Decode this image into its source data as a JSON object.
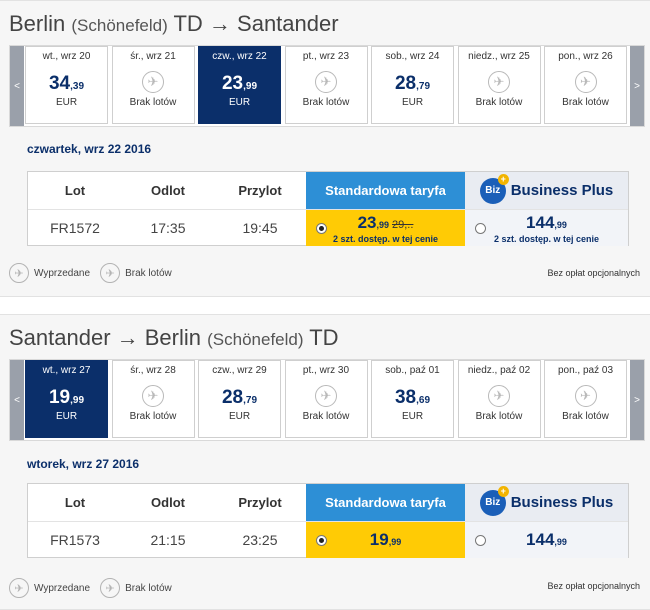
{
  "outbound": {
    "route_main": "Berlin",
    "route_small": "(Schönefeld)",
    "route_rest": " TD → Santander",
    "days": [
      {
        "label": "wt., wrz 20",
        "price_main": "34",
        "price_dec": ",39",
        "currency": "EUR",
        "selected": false
      },
      {
        "label": "śr., wrz 21",
        "no_flights": "Brak lotów",
        "selected": false
      },
      {
        "label": "czw., wrz 22",
        "price_main": "23",
        "price_dec": ",99",
        "currency": "EUR",
        "selected": true
      },
      {
        "label": "pt., wrz 23",
        "no_flights": "Brak lotów",
        "selected": false
      },
      {
        "label": "sob., wrz 24",
        "price_main": "28",
        "price_dec": ",79",
        "currency": "EUR",
        "selected": false
      },
      {
        "label": "niedz., wrz 25",
        "no_flights": "Brak lotów",
        "selected": false
      },
      {
        "label": "pon., wrz 26",
        "no_flights": "Brak lotów",
        "selected": false
      }
    ],
    "date_heading": "czwartek, wrz 22 2016",
    "headers": {
      "flight": "Lot",
      "departure": "Odlot",
      "arrival": "Przylot",
      "standard": "Standardowa taryfa",
      "business": "Business Plus"
    },
    "row": {
      "flight": "FR1572",
      "departure": "17:35",
      "arrival": "19:45",
      "std_main": "23",
      "std_dec": ",99",
      "std_old": "29,..",
      "std_seats": "2 szt. dostęp. w tej cenie",
      "bp_main": "144",
      "bp_dec": ",99",
      "bp_seats": "2 szt. dostęp. w tej cenie"
    }
  },
  "inbound": {
    "route_main": "Santander → Berlin",
    "route_small": "(Schönefeld)",
    "route_rest": " TD",
    "days": [
      {
        "label": "wt., wrz 27",
        "price_main": "19",
        "price_dec": ",99",
        "currency": "EUR",
        "selected": true
      },
      {
        "label": "śr., wrz 28",
        "no_flights": "Brak lotów",
        "selected": false
      },
      {
        "label": "czw., wrz 29",
        "price_main": "28",
        "price_dec": ",79",
        "currency": "EUR",
        "selected": false
      },
      {
        "label": "pt., wrz 30",
        "no_flights": "Brak lotów",
        "selected": false
      },
      {
        "label": "sob., paź 01",
        "price_main": "38",
        "price_dec": ",69",
        "currency": "EUR",
        "selected": false
      },
      {
        "label": "niedz., paź 02",
        "no_flights": "Brak lotów",
        "selected": false
      },
      {
        "label": "pon., paź 03",
        "no_flights": "Brak lotów",
        "selected": false
      }
    ],
    "date_heading": "wtorek, wrz 27 2016",
    "headers": {
      "flight": "Lot",
      "departure": "Odlot",
      "arrival": "Przylot",
      "standard": "Standardowa taryfa",
      "business": "Business Plus"
    },
    "row": {
      "flight": "FR1573",
      "departure": "21:15",
      "arrival": "23:25",
      "std_main": "19",
      "std_dec": ",99",
      "bp_main": "144",
      "bp_dec": ",99"
    }
  },
  "legend": {
    "sold_out": "Wyprzedane",
    "no_flights": "Brak lotów",
    "optional_fees": "Bez opłat opcjonalnych"
  },
  "nav": {
    "prev": "<",
    "next": ">"
  },
  "biz_logo": "Biz",
  "colors": {
    "brand_dark": "#0b2f6a",
    "standard": "#2d8fd6",
    "fare_yellow": "#ffcb05"
  },
  "icons": {
    "no_flights": "plane-crossed-icon",
    "sold_out": "plane-down-icon"
  }
}
